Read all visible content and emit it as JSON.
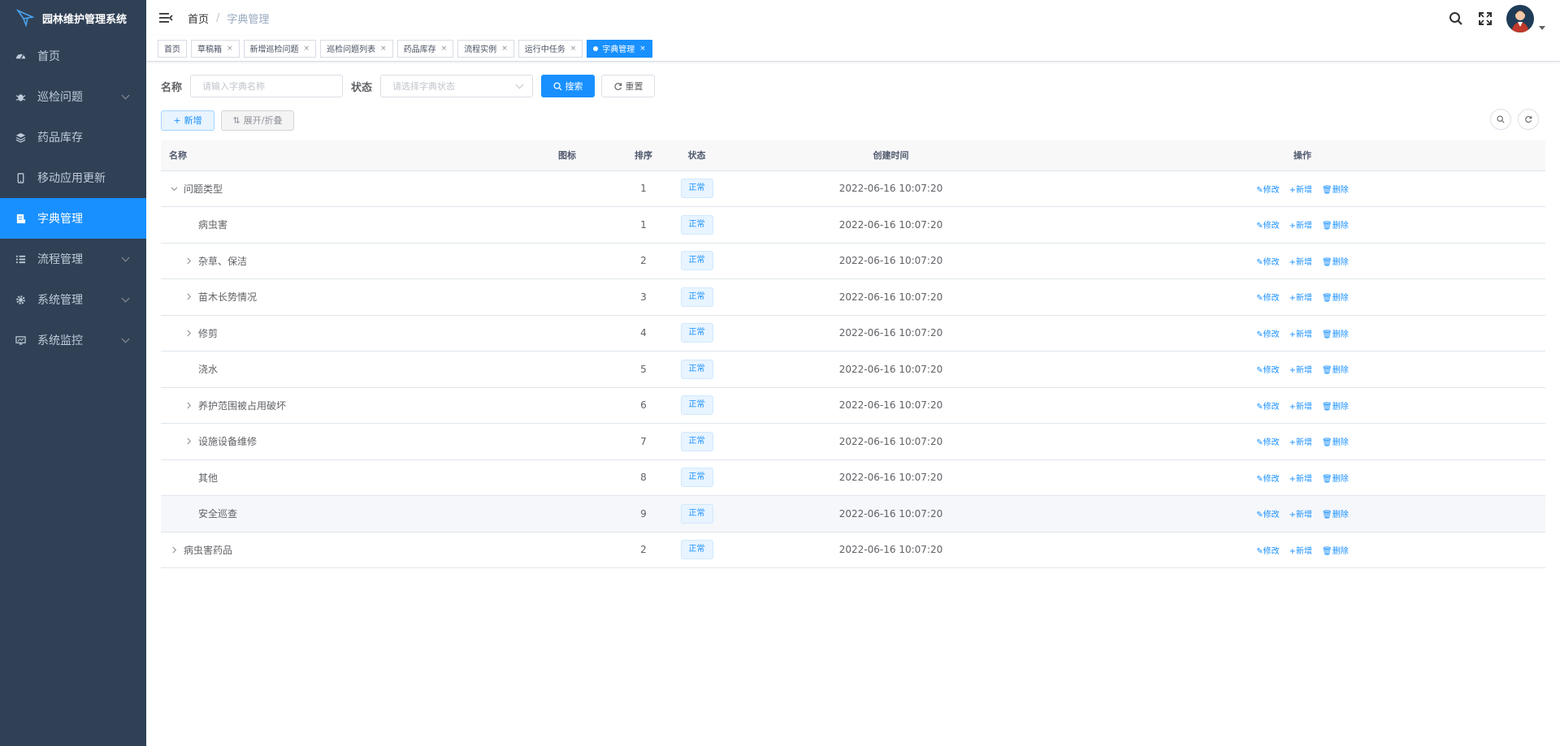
{
  "app": {
    "title": "园林维护管理系统"
  },
  "menu": [
    {
      "label": "首页",
      "icon": "dashboard-icon"
    },
    {
      "label": "巡检问题",
      "icon": "bug-icon"
    },
    {
      "label": "药品库存",
      "icon": "stack-icon"
    },
    {
      "label": "移动应用更新",
      "icon": "phone-icon"
    },
    {
      "label": "字典管理",
      "icon": "dict-icon"
    },
    {
      "label": "流程管理",
      "icon": "list-icon"
    },
    {
      "label": "系统管理",
      "icon": "gear-icon"
    },
    {
      "label": "系统监控",
      "icon": "monitor-icon"
    }
  ],
  "breadcrumb": {
    "home": "首页",
    "sep": "/",
    "current": "字典管理"
  },
  "tags": [
    "首页",
    "草稿箱",
    "新增巡检问题",
    "巡检问题列表",
    "药品库存",
    "流程实例",
    "运行中任务",
    "字典管理"
  ],
  "tag_close": "×",
  "search": {
    "name_label": "名称",
    "name_placeholder": "请输入字典名称",
    "status_label": "状态",
    "status_placeholder": "请选择字典状态",
    "search_btn": "搜索",
    "reset_btn": "重置"
  },
  "toolbar": {
    "add": "新增",
    "expand": "展开/折叠"
  },
  "table": {
    "headers": {
      "name": "名称",
      "icon": "图标",
      "order": "排序",
      "status": "状态",
      "created": "创建时间",
      "ops": "操作"
    },
    "ops": {
      "edit": "修改",
      "add": "新增",
      "delete": "删除"
    },
    "rows": [
      {
        "name": "问题类型",
        "order": "1",
        "status": "正常",
        "created": "2022-06-16 10:07:20"
      },
      {
        "name": "病虫害",
        "order": "1",
        "status": "正常",
        "created": "2022-06-16 10:07:20"
      },
      {
        "name": "杂草、保洁",
        "order": "2",
        "status": "正常",
        "created": "2022-06-16 10:07:20"
      },
      {
        "name": "苗木长势情况",
        "order": "3",
        "status": "正常",
        "created": "2022-06-16 10:07:20"
      },
      {
        "name": "修剪",
        "order": "4",
        "status": "正常",
        "created": "2022-06-16 10:07:20"
      },
      {
        "name": "浇水",
        "order": "5",
        "status": "正常",
        "created": "2022-06-16 10:07:20"
      },
      {
        "name": "养护范围被占用破坏",
        "order": "6",
        "status": "正常",
        "created": "2022-06-16 10:07:20"
      },
      {
        "name": "设施设备维修",
        "order": "7",
        "status": "正常",
        "created": "2022-06-16 10:07:20"
      },
      {
        "name": "其他",
        "order": "8",
        "status": "正常",
        "created": "2022-06-16 10:07:20"
      },
      {
        "name": "安全巡查",
        "order": "9",
        "status": "正常",
        "created": "2022-06-16 10:07:20"
      },
      {
        "name": "病虫害药品",
        "order": "2",
        "status": "正常",
        "created": "2022-06-16 10:07:20"
      }
    ]
  },
  "colors": {
    "sidebar": "#304156",
    "accent": "#1890ff"
  }
}
